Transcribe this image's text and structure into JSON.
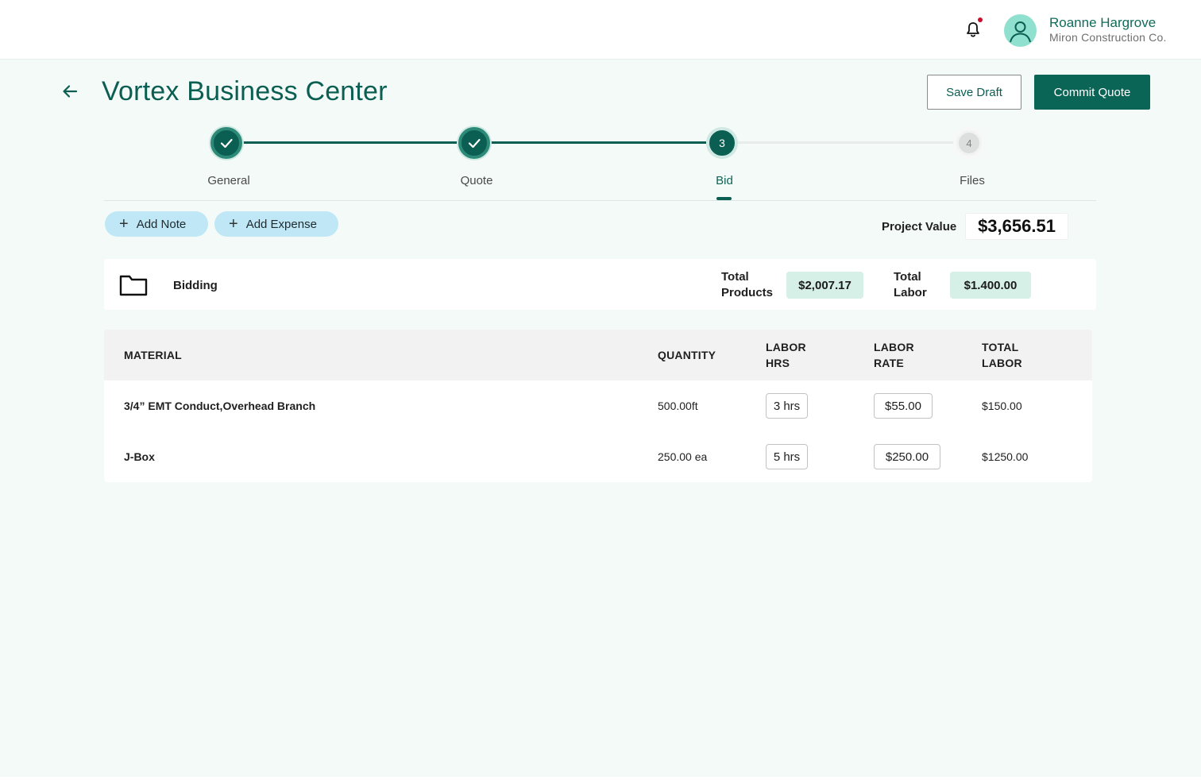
{
  "header": {
    "user_name": "Roanne Hargrove",
    "user_company": "Miron Construction Co.",
    "notification_icon": "bell-icon",
    "notification_dot_color": "#c8102e"
  },
  "page": {
    "title": "Vortex Business Center",
    "save_draft_label": "Save Draft",
    "commit_quote_label": "Commit Quote"
  },
  "stepper": {
    "steps": [
      {
        "label": "General",
        "status": "done"
      },
      {
        "label": "Quote",
        "status": "done"
      },
      {
        "label": "Bid",
        "number": "3",
        "status": "current"
      },
      {
        "label": "Files",
        "number": "4",
        "status": "todo"
      }
    ]
  },
  "actions": {
    "add_note_label": "Add Note",
    "add_expense_label": "Add Expense"
  },
  "project_value": {
    "label": "Project Value",
    "value": "$3,656.51"
  },
  "bidding": {
    "title": "Bidding",
    "total_products_label_1": "Total",
    "total_products_label_2": "Products",
    "total_products_value": "$2,007.17",
    "total_labor_label_1": "Total",
    "total_labor_label_2": "Labor",
    "total_labor_value": "$1.400.00"
  },
  "table": {
    "headers": {
      "material": "MATERIAL",
      "quantity": "QUANTITY",
      "labor_hrs_1": "LABOR",
      "labor_hrs_2": "HRS",
      "labor_rate_1": "LABOR",
      "labor_rate_2": "RATE",
      "total_labor_1": "TOTAL",
      "total_labor_2": "LABOR"
    },
    "rows": [
      {
        "material": "3/4” EMT Conduct,Overhead Branch",
        "quantity": "500.00ft",
        "labor_hrs": "3 hrs",
        "labor_rate": "$55.00",
        "total_labor": "$150.00"
      },
      {
        "material": "J-Box",
        "quantity": "250.00 ea",
        "labor_hrs": "5 hrs",
        "labor_rate": "$250.00",
        "total_labor": "$1250.00"
      }
    ]
  },
  "colors": {
    "brand": "#0b5e52",
    "background": "#f4faf8",
    "pill": "#bfe7f6",
    "badge": "#d6efe7"
  }
}
